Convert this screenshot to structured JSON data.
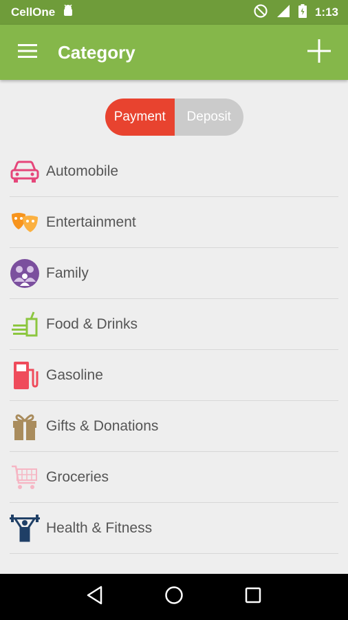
{
  "status_bar": {
    "carrier": "CellOne",
    "time": "1:13"
  },
  "app_bar": {
    "title": "Category"
  },
  "toggle": {
    "payment_label": "Payment",
    "deposit_label": "Deposit",
    "selected": "Payment"
  },
  "categories": [
    {
      "label": "Automobile",
      "icon": "car-icon",
      "color": "#e5467a"
    },
    {
      "label": "Entertainment",
      "icon": "masks-icon",
      "color": "#f7941d"
    },
    {
      "label": "Family",
      "icon": "family-icon",
      "color": "#7b4f9e"
    },
    {
      "label": "Food & Drinks",
      "icon": "food-drinks-icon",
      "color": "#8cc63f"
    },
    {
      "label": "Gasoline",
      "icon": "gas-pump-icon",
      "color": "#ef4b5b"
    },
    {
      "label": "Gifts & Donations",
      "icon": "gift-icon",
      "color": "#a98c5d"
    },
    {
      "label": "Groceries",
      "icon": "shopping-cart-icon",
      "color": "#f6b6c4"
    },
    {
      "label": "Health & Fitness",
      "icon": "weightlifter-icon",
      "color": "#1f3f66"
    }
  ],
  "colors": {
    "app_bar": "#85b74a",
    "status_bar": "#6f9c3a",
    "toggle_active": "#e8432f",
    "toggle_inactive": "#cbcbcb"
  }
}
